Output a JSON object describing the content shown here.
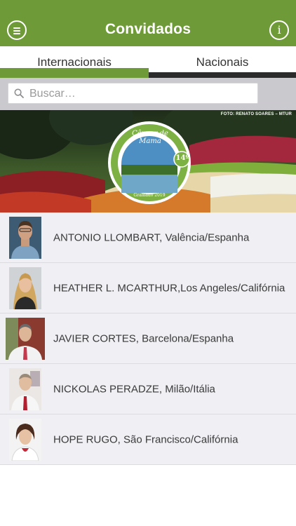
{
  "header": {
    "title": "Convidados",
    "menu_icon": "menu-icon",
    "info_icon": "info-icon",
    "color": "#6f9a38"
  },
  "tabs": [
    {
      "label": "Internacionais",
      "active": true
    },
    {
      "label": "Nacionais",
      "active": false
    }
  ],
  "search": {
    "placeholder": "Buscar…",
    "icon": "search-icon"
  },
  "banner": {
    "photo_credit": "FOTO: RENATO SOARES – MTUR",
    "logo_text": "Câncer de Mama",
    "logo_edition": "14º",
    "logo_city": "Gramado 2019"
  },
  "guests": [
    {
      "name": "ANTONIO LLOMBART, Valência/Espanha",
      "photo": "guest-photo"
    },
    {
      "name": "HEATHER L. MCARTHUR,Los Angeles/Califórnia",
      "photo": "guest-photo"
    },
    {
      "name": "JAVIER CORTES, Barcelona/Espanha",
      "photo": "guest-photo"
    },
    {
      "name": "NICKOLAS PERADZE, Milão/Itália",
      "photo": "guest-photo"
    },
    {
      "name": "HOPE RUGO, São Francisco/Califórnia",
      "photo": "guest-photo"
    }
  ]
}
